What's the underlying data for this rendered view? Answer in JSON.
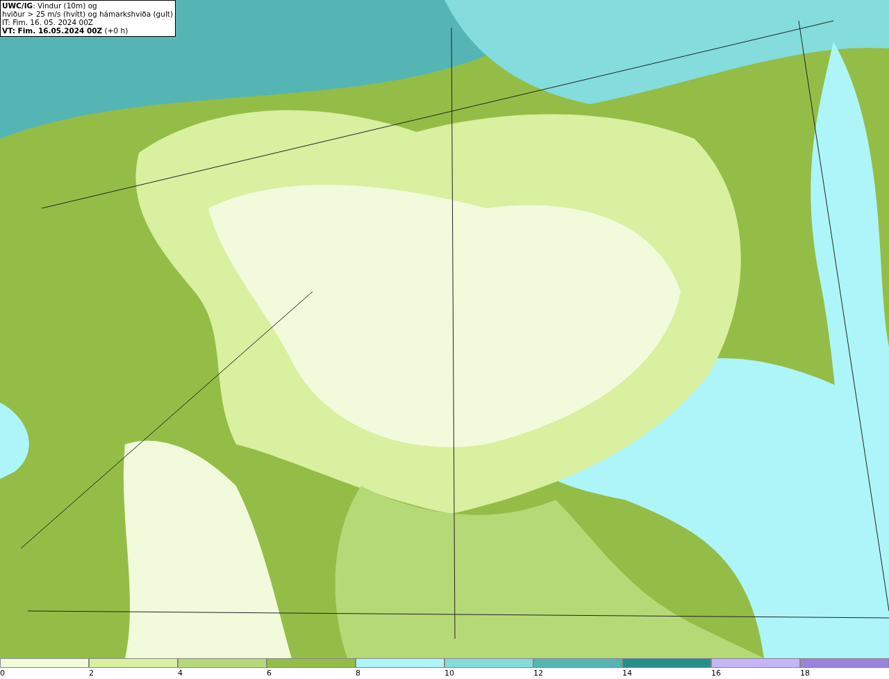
{
  "info_box": {
    "lines": [
      "**UWC/IG**: Vindur (10m) og",
      "hviður > 25 m/s (hvítt) og hámarkshviða (gult)",
      "IT: Fim. 16. 05. 2024 00Z",
      "**VT: Fim. 16.05.2024 00Z** (+0 h)"
    ]
  },
  "legend": {
    "bins": [
      {
        "label": "0",
        "color": "#f2fadc"
      },
      {
        "label": "2",
        "color": "#d8f0a0"
      },
      {
        "label": "4",
        "color": "#b6d978"
      },
      {
        "label": "6",
        "color": "#94bd47"
      },
      {
        "label": "8",
        "color": "#adf5f8"
      },
      {
        "label": "10",
        "color": "#84dcdc"
      },
      {
        "label": "12",
        "color": "#55b5b5"
      },
      {
        "label": "14",
        "color": "#248f8f"
      },
      {
        "label": "16",
        "color": "#c4b5f8"
      },
      {
        "label": "18",
        "color": "#9b82dc"
      }
    ]
  }
}
